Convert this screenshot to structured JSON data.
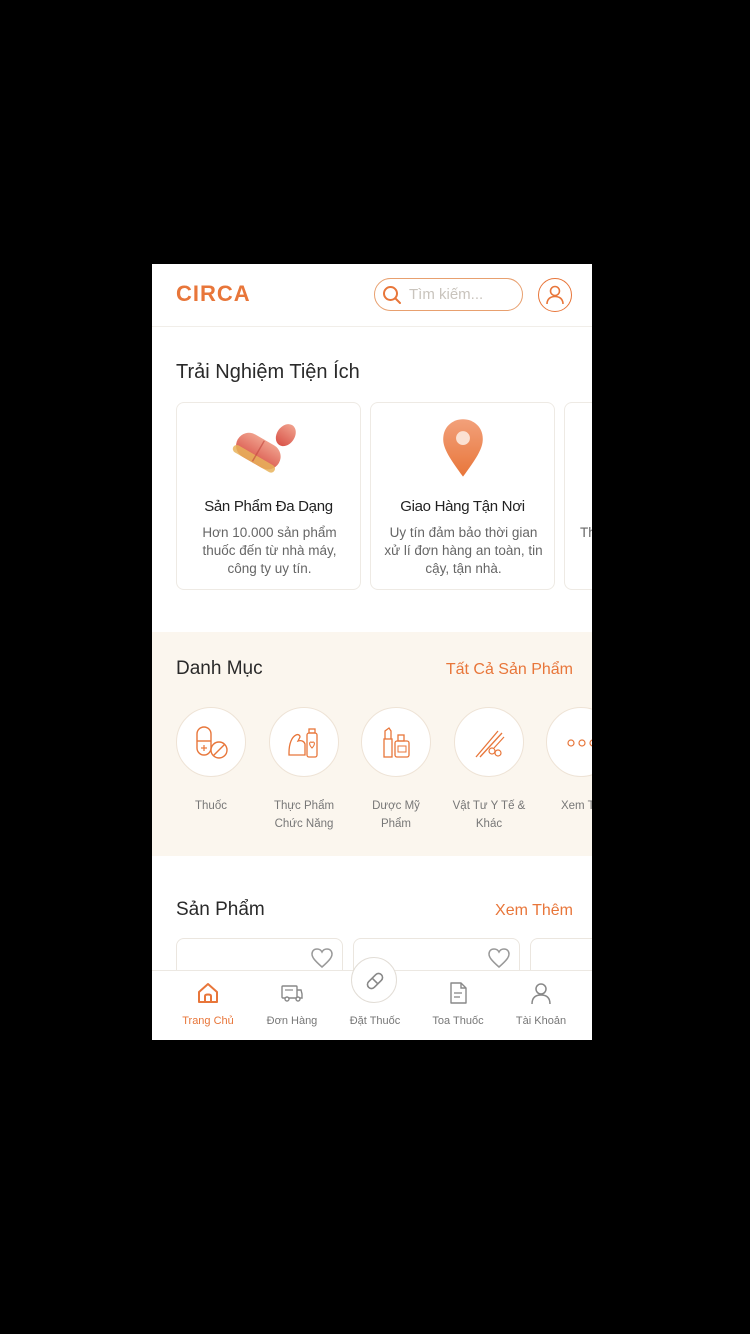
{
  "header": {
    "logo": "CIRCA",
    "search_placeholder": "Tìm kiếm..."
  },
  "experience": {
    "title": "Trải Nghiệm Tiện Ích",
    "cards": [
      {
        "icon": "pill-icon",
        "title": "Sản Phẩm Đa Dạng",
        "desc": "Hơn 10.000 sản phẩm thuốc đến từ nhà máy, công ty uy tín."
      },
      {
        "icon": "location-pin-icon",
        "title": "Giao Hàng Tận Nơi",
        "desc": "Uy tín đảm bảo thời gian xử lí đơn hàng an toàn, tin cậy, tận nhà."
      },
      {
        "icon": "",
        "title": "",
        "desc": "Th"
      }
    ]
  },
  "categories": {
    "title": "Danh Mục",
    "link": "Tất Cả Sản Phẩm",
    "items": [
      {
        "icon": "capsule-icon",
        "label": "Thuốc"
      },
      {
        "icon": "supplement-icon",
        "label": "Thực Phẩm Chức Năng"
      },
      {
        "icon": "cosmetics-icon",
        "label": "Dược Mỹ Phẩm"
      },
      {
        "icon": "medical-tools-icon",
        "label": "Vật Tư Y Tế & Khác"
      },
      {
        "icon": "more-icon",
        "label": "Xem Th"
      }
    ]
  },
  "products": {
    "title": "Sản Phẩm",
    "link": "Xem Thêm"
  },
  "bottom_nav": {
    "items": [
      {
        "icon": "home-icon",
        "label": "Trang Chủ",
        "active": true
      },
      {
        "icon": "delivery-truck-icon",
        "label": "Đơn Hàng",
        "active": false
      },
      {
        "icon": "pill-icon",
        "label": "Đặt Thuốc",
        "active": false
      },
      {
        "icon": "prescription-icon",
        "label": "Toa Thuốc",
        "active": false
      },
      {
        "icon": "user-icon",
        "label": "Tài Khoản",
        "active": false
      }
    ]
  },
  "colors": {
    "accent": "#e8763a",
    "category_bg": "#fbf6ee"
  }
}
